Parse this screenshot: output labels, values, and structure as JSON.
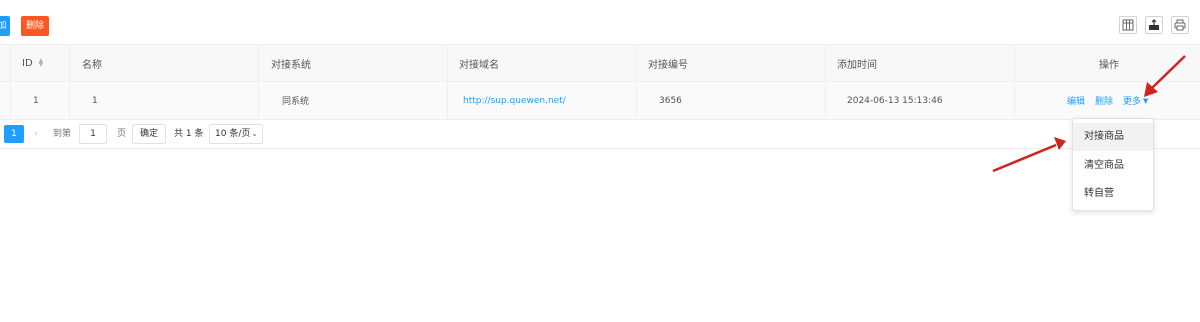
{
  "toolbar": {
    "add_label": "加",
    "delete_label": "删除",
    "icons": [
      "columns-icon",
      "export-icon",
      "print-icon"
    ]
  },
  "table": {
    "headers": {
      "id": "ID",
      "name": "名称",
      "system": "对接系统",
      "domain": "对接域名",
      "code": "对接编号",
      "time": "添加时间",
      "actions": "操作"
    },
    "rows": [
      {
        "id": "1",
        "name": "1",
        "system": "同系统",
        "domain": "http://sup.quewen.net/",
        "code": "3656",
        "time": "2024-06-13 15:13:46",
        "edit": "编辑",
        "delete": "删除",
        "more": "更多"
      }
    ]
  },
  "pager": {
    "current_page": "1",
    "goto_label": "到第",
    "input_value": "1",
    "page_unit": "页",
    "confirm": "确定",
    "total": "共 1 条",
    "page_size": "10 条/页"
  },
  "dropdown": {
    "items": [
      "对接商品",
      "清空商品",
      "转自营"
    ]
  },
  "colors": {
    "primary": "#1e9fff",
    "danger": "#ff5722",
    "arrow": "#d0231c"
  }
}
